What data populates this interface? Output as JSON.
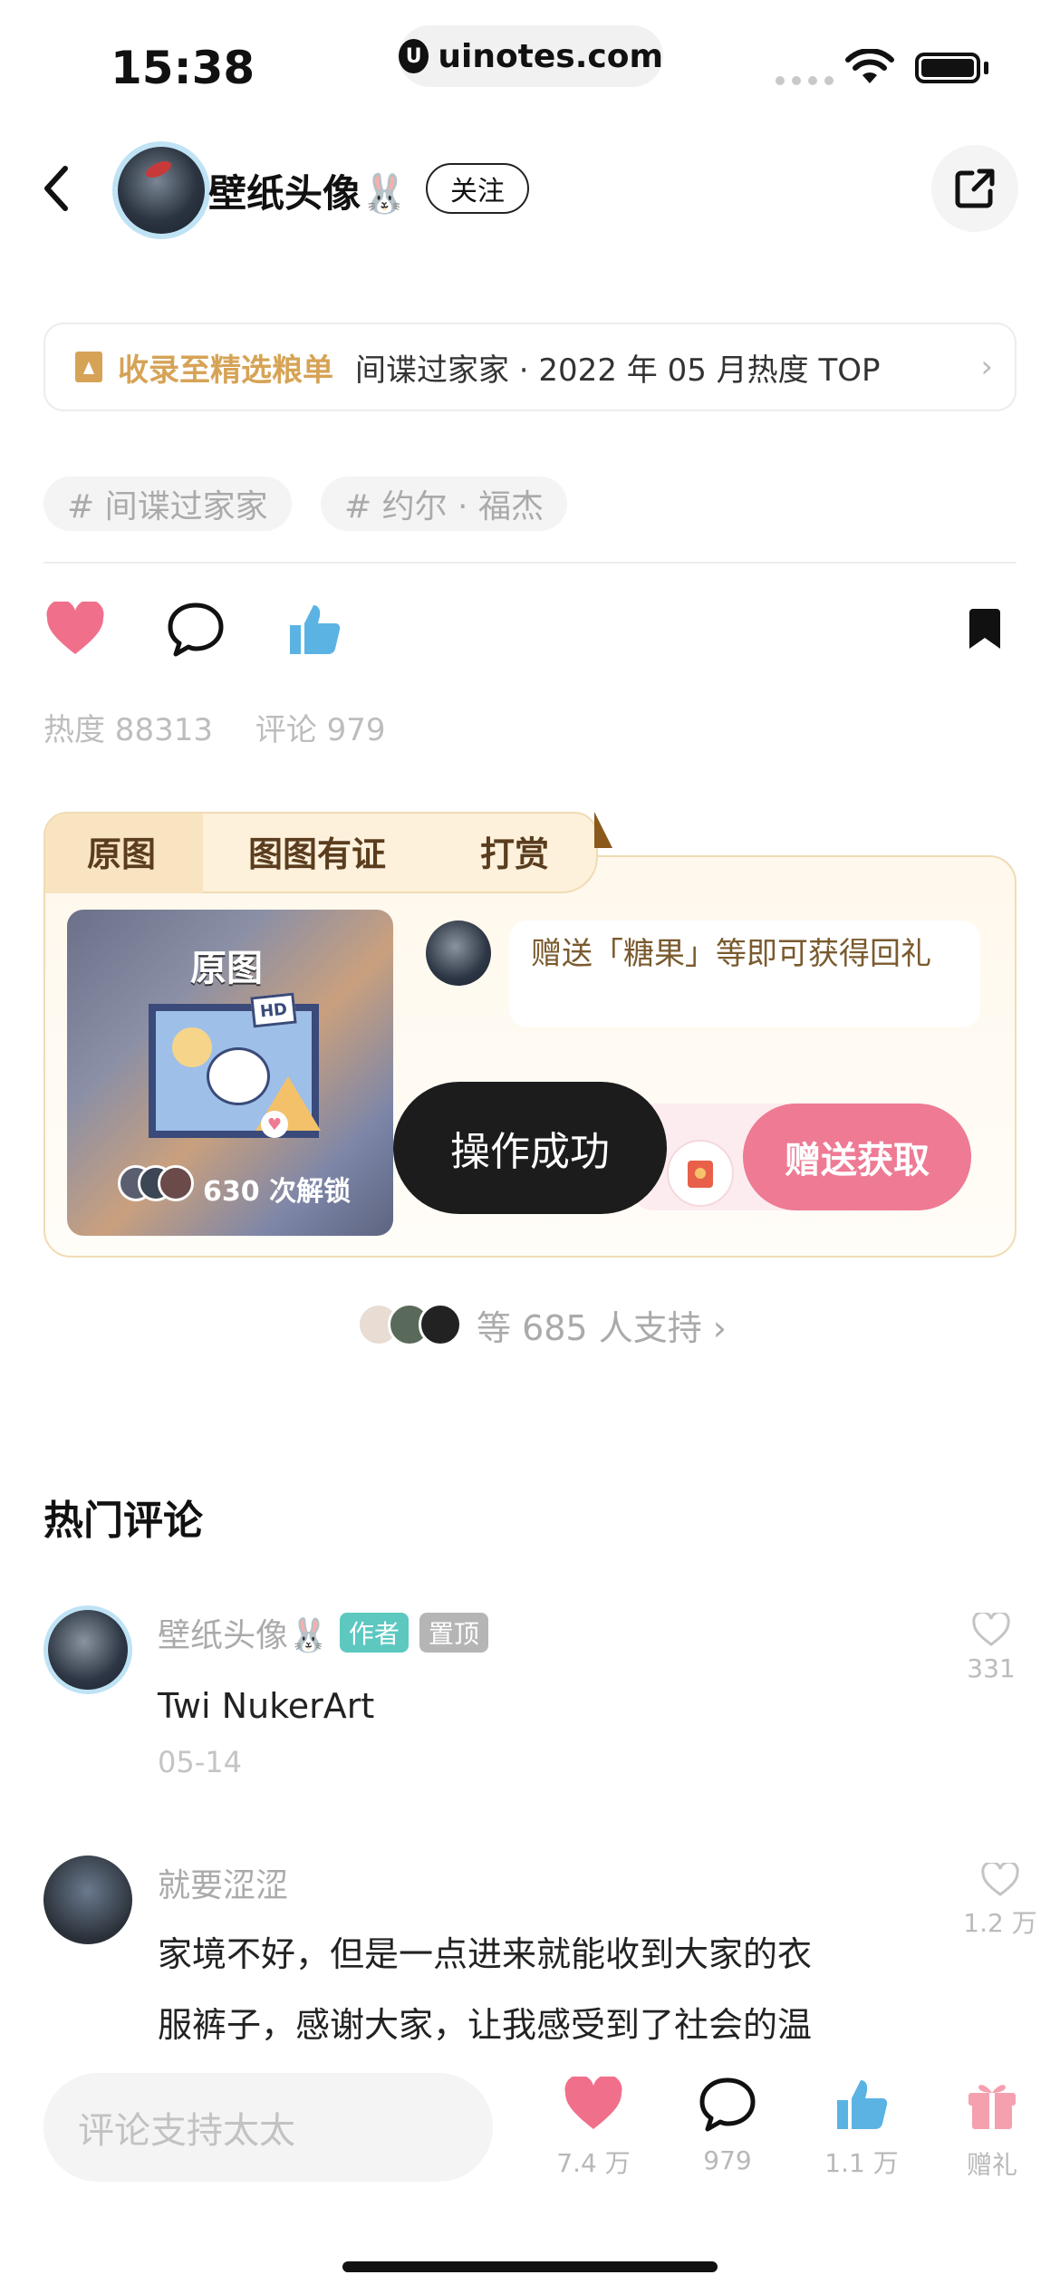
{
  "status_bar": {
    "time": "15:38",
    "url": "uinotes.com"
  },
  "header": {
    "author_name": "壁纸头像🐰",
    "follow_label": "关注"
  },
  "collection": {
    "tag": "收录至精选粮单",
    "desc": "间谍过家家 · 2022 年 05 月热度 TOP"
  },
  "hashtags": [
    "# 间谍过家家",
    "# 约尔 · 福杰"
  ],
  "stats": {
    "heat": "热度 88313",
    "comments": "评论 979"
  },
  "reward": {
    "tabs": [
      "原图",
      "图图有证",
      "打赏"
    ],
    "thumb_title": "原图",
    "thumb_badge": "HD",
    "unlock_count": "630 次解锁",
    "bubble_text": "赠送「糖果」等即可获得回礼",
    "send_button": "赠送获取",
    "toast": "操作成功"
  },
  "supporters": {
    "text": "等 685 人支持 ›"
  },
  "comments_section": {
    "title": "热门评论",
    "items": [
      {
        "name": "壁纸头像🐰",
        "badges": [
          "作者",
          "置顶"
        ],
        "text": "Twi NukerArt",
        "date": "05-14",
        "likes": "331"
      },
      {
        "name": "就要涩涩",
        "text_line1": "家境不好，但是一点进来就能收到大家的衣",
        "text_line2": "服裤子，感谢大家，让我感受到了社会的温",
        "likes": "1.2 万"
      }
    ]
  },
  "bottom_bar": {
    "input_placeholder": "评论支持太太",
    "like_count": "7.4 万",
    "comment_count": "979",
    "thumb_count": "1.1 万",
    "gift_label": "赠礼"
  },
  "colors": {
    "accent_pink": "#ee7a94",
    "heart": "#f0708c",
    "thumb_blue": "#5bb3e4",
    "gold": "#d6a356",
    "author_badge": "#5cc8c0"
  }
}
